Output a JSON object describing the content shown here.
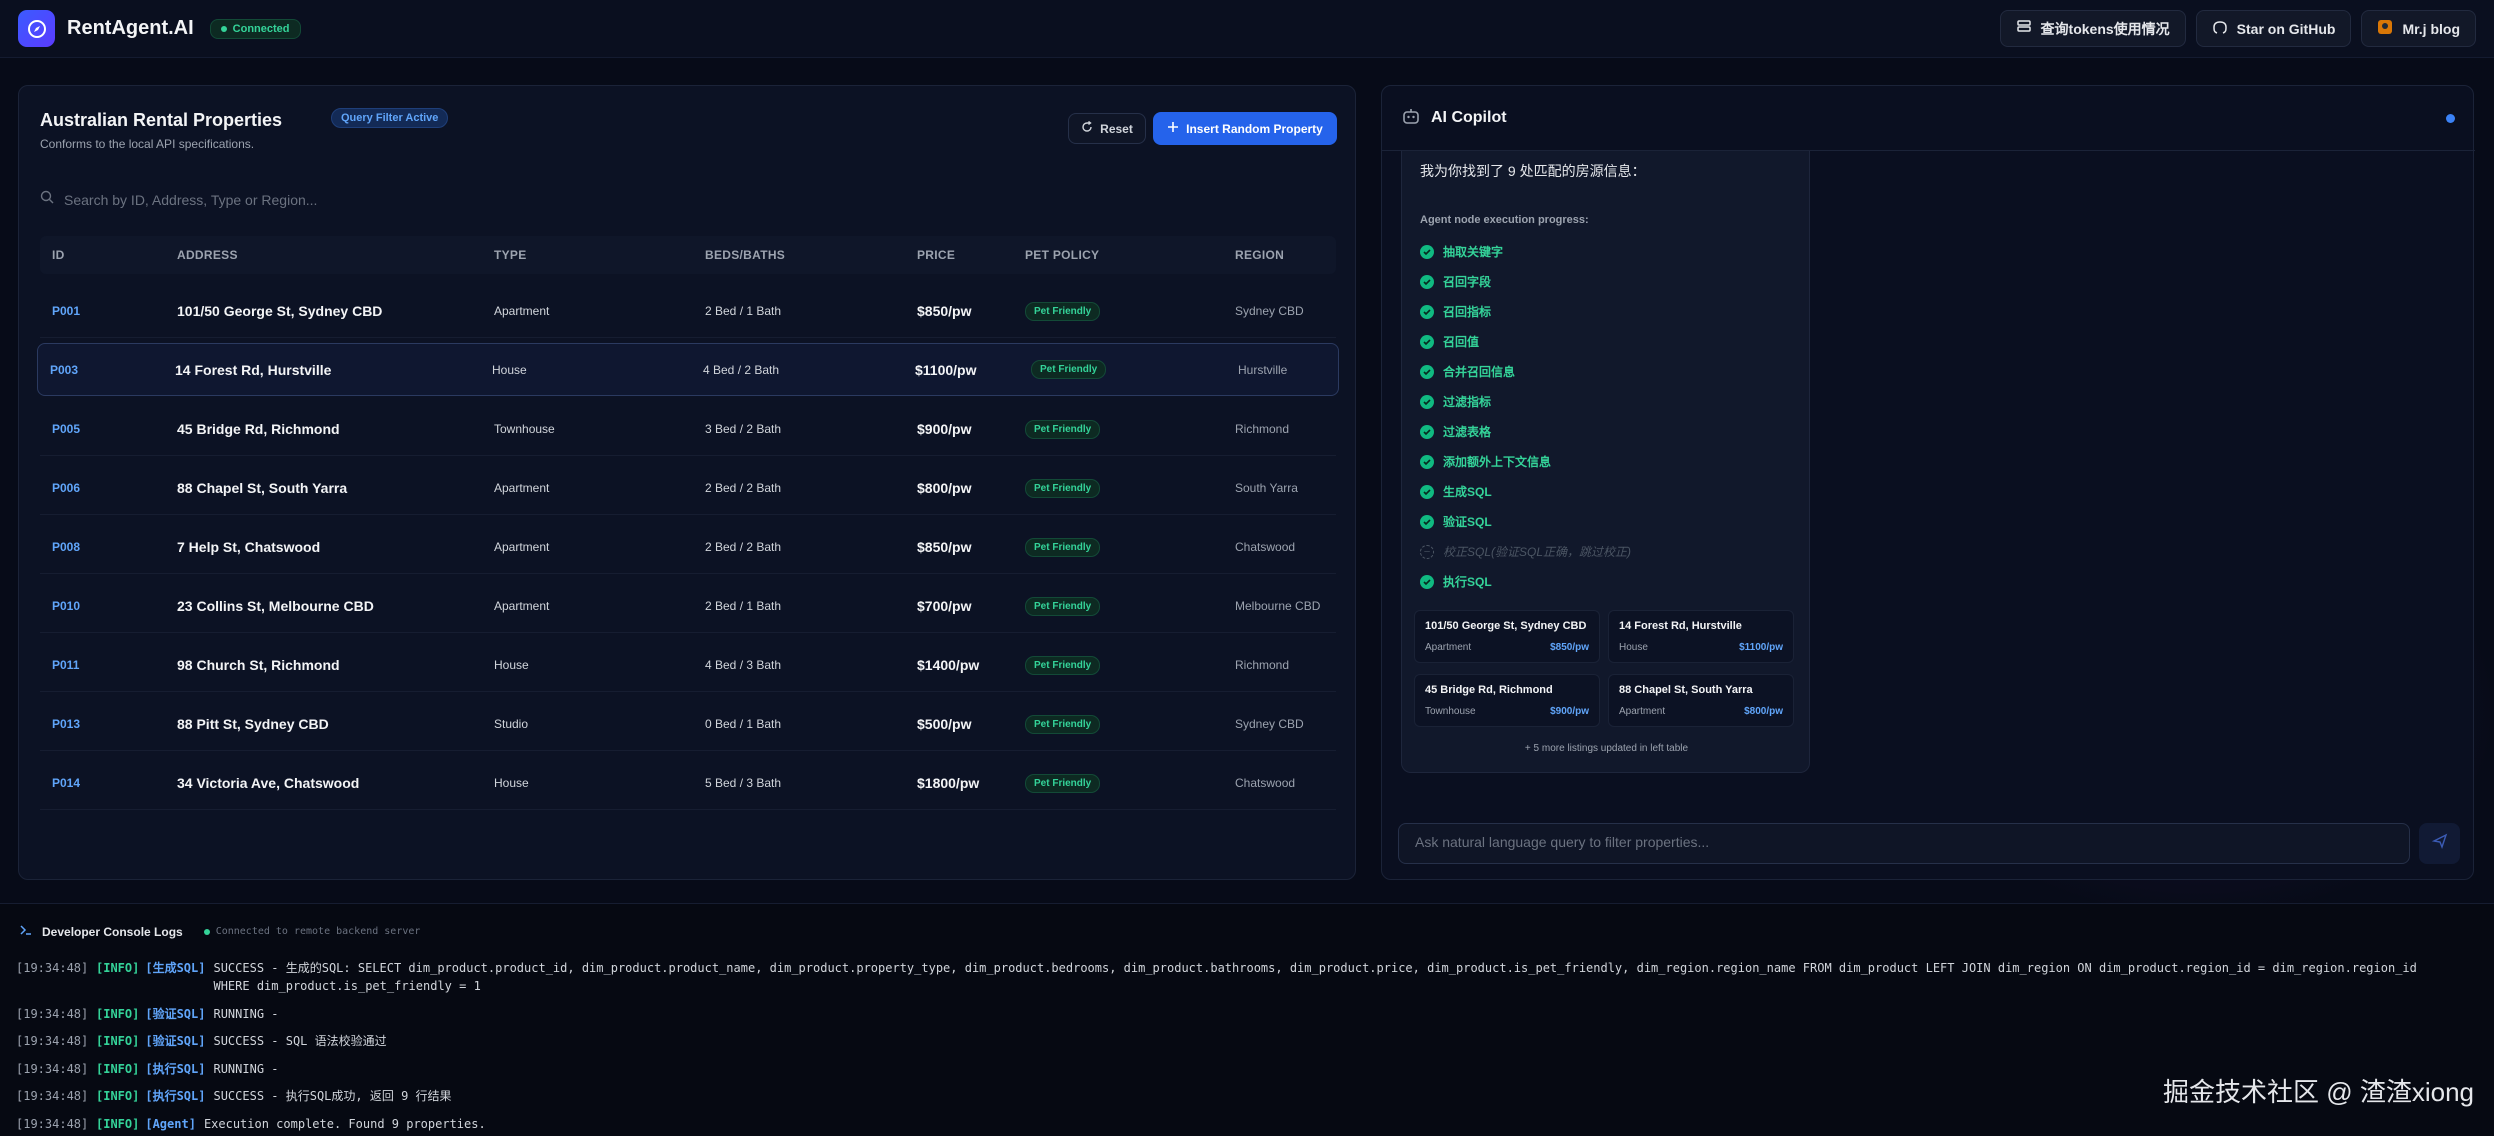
{
  "header": {
    "brand": "RentAgent.AI",
    "connection_status": "Connected",
    "buttons": [
      {
        "label": "查询tokens使用情况",
        "icon": "database-icon"
      },
      {
        "label": "Star on GitHub",
        "icon": "github-icon"
      },
      {
        "label": "Mr.j blog",
        "icon": "blog-avatar-icon"
      }
    ]
  },
  "left_panel": {
    "title": "Australian Rental Properties",
    "filter_badge": "Query Filter Active",
    "subtitle": "Conforms to the local API specifications.",
    "reset_label": "Reset",
    "insert_label": "Insert Random Property",
    "search_placeholder": "Search by ID, Address, Type or Region...",
    "columns": [
      "ID",
      "ADDRESS",
      "TYPE",
      "BEDS/BATHS",
      "PRICE",
      "PET POLICY",
      "REGION"
    ],
    "rows": [
      {
        "id": "P001",
        "address": "101/50 George St, Sydney CBD",
        "type": "Apartment",
        "beds_baths": "2 Bed / 1 Bath",
        "price": "$850/pw",
        "pet": "Pet Friendly",
        "region": "Sydney CBD"
      },
      {
        "id": "P003",
        "address": "14 Forest Rd, Hurstville",
        "type": "House",
        "beds_baths": "4 Bed / 2 Bath",
        "price": "$1100/pw",
        "pet": "Pet Friendly",
        "region": "Hurstville"
      },
      {
        "id": "P005",
        "address": "45 Bridge Rd, Richmond",
        "type": "Townhouse",
        "beds_baths": "3 Bed / 2 Bath",
        "price": "$900/pw",
        "pet": "Pet Friendly",
        "region": "Richmond"
      },
      {
        "id": "P006",
        "address": "88 Chapel St, South Yarra",
        "type": "Apartment",
        "beds_baths": "2 Bed / 2 Bath",
        "price": "$800/pw",
        "pet": "Pet Friendly",
        "region": "South Yarra"
      },
      {
        "id": "P008",
        "address": "7 Help St, Chatswood",
        "type": "Apartment",
        "beds_baths": "2 Bed / 2 Bath",
        "price": "$850/pw",
        "pet": "Pet Friendly",
        "region": "Chatswood"
      },
      {
        "id": "P010",
        "address": "23 Collins St, Melbourne CBD",
        "type": "Apartment",
        "beds_baths": "2 Bed / 1 Bath",
        "price": "$700/pw",
        "pet": "Pet Friendly",
        "region": "Melbourne CBD"
      },
      {
        "id": "P011",
        "address": "98 Church St, Richmond",
        "type": "House",
        "beds_baths": "4 Bed / 3 Bath",
        "price": "$1400/pw",
        "pet": "Pet Friendly",
        "region": "Richmond"
      },
      {
        "id": "P013",
        "address": "88 Pitt St, Sydney CBD",
        "type": "Studio",
        "beds_baths": "0 Bed / 1 Bath",
        "price": "$500/pw",
        "pet": "Pet Friendly",
        "region": "Sydney CBD"
      },
      {
        "id": "P014",
        "address": "34 Victoria Ave, Chatswood",
        "type": "House",
        "beds_baths": "5 Bed / 3 Bath",
        "price": "$1800/pw",
        "pet": "Pet Friendly",
        "region": "Chatswood"
      }
    ]
  },
  "copilot": {
    "title": "AI Copilot",
    "message_title": "我为你找到了 9 处匹配的房源信息：",
    "progress_label": "Agent node execution progress:",
    "steps": [
      {
        "label": "抽取关键字",
        "status": "done"
      },
      {
        "label": "召回字段",
        "status": "done"
      },
      {
        "label": "召回指标",
        "status": "done"
      },
      {
        "label": "召回值",
        "status": "done"
      },
      {
        "label": "合并召回信息",
        "status": "done"
      },
      {
        "label": "过滤指标",
        "status": "done"
      },
      {
        "label": "过滤表格",
        "status": "done"
      },
      {
        "label": "添加额外上下文信息",
        "status": "done"
      },
      {
        "label": "生成SQL",
        "status": "done"
      },
      {
        "label": "验证SQL",
        "status": "done"
      },
      {
        "label": "校正SQL(验证SQL正确，跳过校正)",
        "status": "skipped"
      },
      {
        "label": "执行SQL",
        "status": "done"
      }
    ],
    "cards": [
      {
        "name": "101/50 George St, Sydney CBD",
        "type": "Apartment",
        "price": "$850/pw"
      },
      {
        "name": "14 Forest Rd, Hurstville",
        "type": "House",
        "price": "$1100/pw"
      },
      {
        "name": "45 Bridge Rd, Richmond",
        "type": "Townhouse",
        "price": "$900/pw"
      },
      {
        "name": "88 Chapel St, South Yarra",
        "type": "Apartment",
        "price": "$800/pw"
      }
    ],
    "more_note": "+ 5 more listings updated in left table",
    "input_placeholder": "Ask natural language query to filter properties..."
  },
  "console": {
    "title": "Developer Console Logs",
    "status": "Connected to remote backend server",
    "logs": [
      {
        "ts": "[19:34:48]",
        "level": "[INFO]",
        "src": "[生成SQL]",
        "text": "SUCCESS - 生成的SQL: SELECT dim_product.product_id, dim_product.product_name, dim_product.property_type, dim_product.bedrooms, dim_product.bathrooms, dim_product.price, dim_product.is_pet_friendly, dim_region.region_name FROM dim_product LEFT JOIN dim_region ON dim_product.region_id = dim_region.region_id WHERE dim_product.is_pet_friendly = 1"
      },
      {
        "ts": "[19:34:48]",
        "level": "[INFO]",
        "src": "[验证SQL]",
        "text": "RUNNING -"
      },
      {
        "ts": "[19:34:48]",
        "level": "[INFO]",
        "src": "[验证SQL]",
        "text": "SUCCESS - SQL 语法校验通过"
      },
      {
        "ts": "[19:34:48]",
        "level": "[INFO]",
        "src": "[执行SQL]",
        "text": "RUNNING -"
      },
      {
        "ts": "[19:34:48]",
        "level": "[INFO]",
        "src": "[执行SQL]",
        "text": "SUCCESS - 执行SQL成功, 返回 9 行结果"
      },
      {
        "ts": "[19:34:48]",
        "level": "[INFO]",
        "src": "[Agent]",
        "text": "Execution complete. Found 9 properties."
      }
    ]
  },
  "watermark": "掘金技术社区 @ 渣渣xiong",
  "colors": {
    "accent": "#2563eb",
    "success": "#34d399",
    "link": "#60a5fa",
    "background": "#070b18"
  }
}
